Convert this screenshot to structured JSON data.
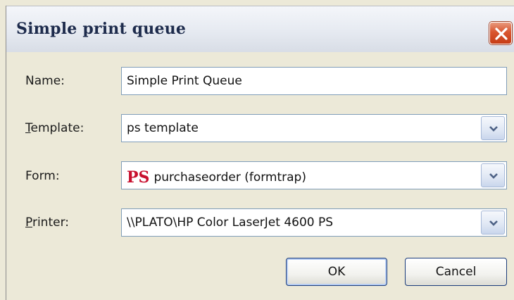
{
  "window": {
    "title": "Simple print queue"
  },
  "fields": {
    "name": {
      "label": "Name:",
      "value": "Simple Print Queue"
    },
    "template": {
      "label_underlined": "T",
      "label_rest": "emplate:",
      "value": "ps template"
    },
    "form": {
      "label": "Form:",
      "logo_text": "PS",
      "value": "purchaseorder (formtrap)"
    },
    "printer": {
      "label_underlined": "P",
      "label_rest": "rinter:",
      "value": "\\\\PLATO\\HP Color LaserJet 4600 PS"
    }
  },
  "buttons": {
    "ok": "OK",
    "cancel": "Cancel"
  },
  "icons": {
    "close": "close-icon",
    "dropdown": "chevron-down-icon",
    "form_logo": "ps-logo-icon"
  },
  "colors": {
    "close_button": "#d9552e",
    "logo": "#c8102e",
    "field_border": "#7f9db9"
  }
}
